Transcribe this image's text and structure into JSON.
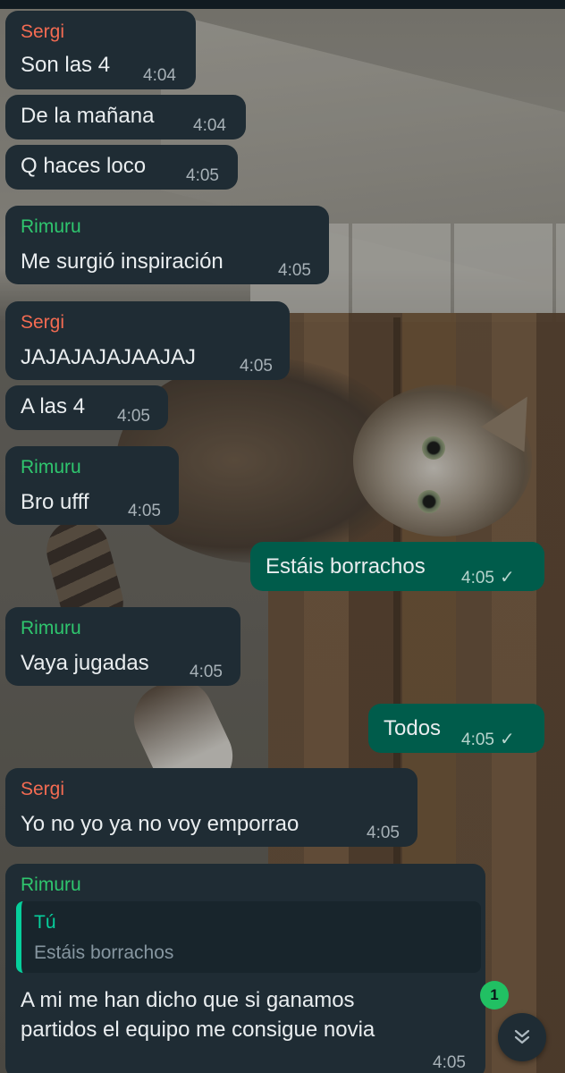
{
  "messages": [
    {
      "sender": "Sergi",
      "text": "Son las 4",
      "time": "4:04"
    },
    {
      "text": "De la mañana",
      "time": "4:04"
    },
    {
      "text": "Q haces loco",
      "time": "4:05"
    },
    {
      "sender": "Rimuru",
      "text": "Me surgió inspiración",
      "time": "4:05"
    },
    {
      "sender": "Sergi",
      "text": "JAJAJAJAJAAJAJ",
      "time": "4:05"
    },
    {
      "text": "A las 4",
      "time": "4:05"
    },
    {
      "sender": "Rimuru",
      "text": "Bro ufff",
      "time": "4:05"
    },
    {
      "text": "Estáis borrachos",
      "time": "4:05",
      "outgoing": true,
      "status_icon": "single-check-icon"
    },
    {
      "sender": "Rimuru",
      "text": "Vaya jugadas",
      "time": "4:05"
    },
    {
      "text": "Todos",
      "time": "4:05",
      "outgoing": true,
      "status_icon": "single-check-icon"
    },
    {
      "sender": "Sergi",
      "text": "Yo no yo ya no voy emporrao",
      "time": "4:05"
    },
    {
      "sender": "Rimuru",
      "quote": {
        "author": "Tú",
        "text": "Estáis borrachos"
      },
      "text_lines": [
        "A mi me han dicho que si ganamos",
        "partidos el equipo me consigue novia"
      ],
      "time": "4:05"
    }
  ],
  "unread_count": "1",
  "check_glyph": "✓",
  "colors": {
    "incoming_bubble": "#1f2c34",
    "outgoing_bubble": "#005c4b",
    "sender_sergi": "#f36b52",
    "sender_rimuru": "#2fc66e",
    "quote_accent": "#06cf9c",
    "unread_badge": "#21c063"
  },
  "icons": {
    "scroll_down": "double-chevron-down-icon"
  }
}
